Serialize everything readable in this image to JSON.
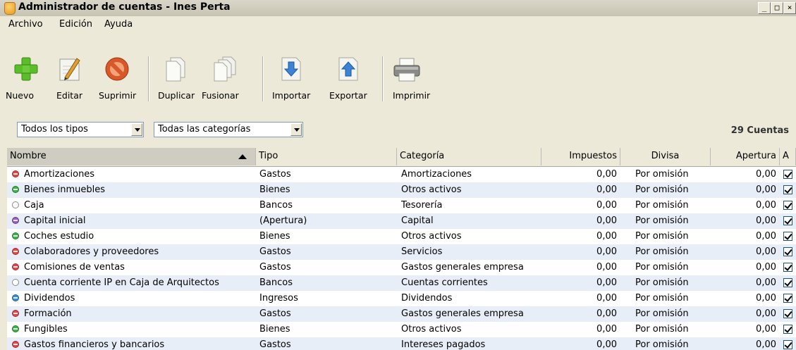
{
  "window": {
    "title": "Administrador de cuentas - Ines Perta",
    "controls": [
      "_",
      "□",
      "×"
    ]
  },
  "menu": [
    "Archivo",
    "Edición",
    "Ayuda"
  ],
  "toolbar": [
    {
      "label": "Nuevo",
      "icon": "plus-icon"
    },
    {
      "label": "Editar",
      "icon": "edit-icon"
    },
    {
      "label": "Suprimir",
      "icon": "delete-icon"
    },
    {
      "label": "Duplicar",
      "icon": "duplicate-icon"
    },
    {
      "label": "Fusionar",
      "icon": "merge-icon"
    },
    {
      "label": "Importar",
      "icon": "import-icon"
    },
    {
      "label": "Exportar",
      "icon": "export-icon"
    },
    {
      "label": "Imprimir",
      "icon": "print-icon"
    }
  ],
  "filters": {
    "type": "Todos los tipos",
    "category": "Todas las categorías"
  },
  "count": "29 Cuentas",
  "columns": [
    "Nombre",
    "Tipo",
    "Categoría",
    "Impuestos",
    "Divisa",
    "Apertura",
    "A"
  ],
  "colors": {
    "gastos": "#e0484a",
    "bienes": "#3fb34a",
    "bancos": "#ffffff",
    "apertura": "#9b5fc4",
    "ingresos": "#3a8fd1"
  },
  "rows": [
    {
      "name": "Amortizaciones",
      "type": "Gastos",
      "category": "Amortizaciones",
      "tax": "0,00",
      "currency": "Por omisión",
      "opening": "0,00",
      "kind": "gastos"
    },
    {
      "name": "Bienes inmuebles",
      "type": "Bienes",
      "category": "Otros activos",
      "tax": "0,00",
      "currency": "Por omisión",
      "opening": "0,00",
      "kind": "bienes"
    },
    {
      "name": "Caja",
      "type": "Bancos",
      "category": "Tesorería",
      "tax": "0,00",
      "currency": "Por omisión",
      "opening": "0,00",
      "kind": "bancos"
    },
    {
      "name": "Capital inicial",
      "type": "(Apertura)",
      "category": "Capital",
      "tax": "0,00",
      "currency": "Por omisión",
      "opening": "0,00",
      "kind": "apertura"
    },
    {
      "name": "Coches estudio",
      "type": "Bienes",
      "category": "Otros activos",
      "tax": "0,00",
      "currency": "Por omisión",
      "opening": "0,00",
      "kind": "bienes"
    },
    {
      "name": "Colaboradores y proveedores",
      "type": "Gastos",
      "category": "Servicios",
      "tax": "0,00",
      "currency": "Por omisión",
      "opening": "0,00",
      "kind": "gastos"
    },
    {
      "name": "Comisiones de ventas",
      "type": "Gastos",
      "category": "Gastos generales empresa",
      "tax": "0,00",
      "currency": "Por omisión",
      "opening": "0,00",
      "kind": "gastos"
    },
    {
      "name": "Cuenta corriente IP en Caja de Arquitectos",
      "type": "Bancos",
      "category": "Cuentas corrientes",
      "tax": "0,00",
      "currency": "Por omisión",
      "opening": "0,00",
      "kind": "bancos"
    },
    {
      "name": "Dividendos",
      "type": "Ingresos",
      "category": "Dividendos",
      "tax": "0,00",
      "currency": "Por omisión",
      "opening": "0,00",
      "kind": "ingresos"
    },
    {
      "name": "Formación",
      "type": "Gastos",
      "category": "Gastos generales empresa",
      "tax": "0,00",
      "currency": "Por omisión",
      "opening": "0,00",
      "kind": "gastos"
    },
    {
      "name": "Fungibles",
      "type": "Bienes",
      "category": "Otros activos",
      "tax": "0,00",
      "currency": "Por omisión",
      "opening": "0,00",
      "kind": "bienes"
    },
    {
      "name": "Gastos financieros y bancarios",
      "type": "Gastos",
      "category": "Intereses pagados",
      "tax": "0,00",
      "currency": "Por omisión",
      "opening": "0,00",
      "kind": "gastos"
    }
  ]
}
